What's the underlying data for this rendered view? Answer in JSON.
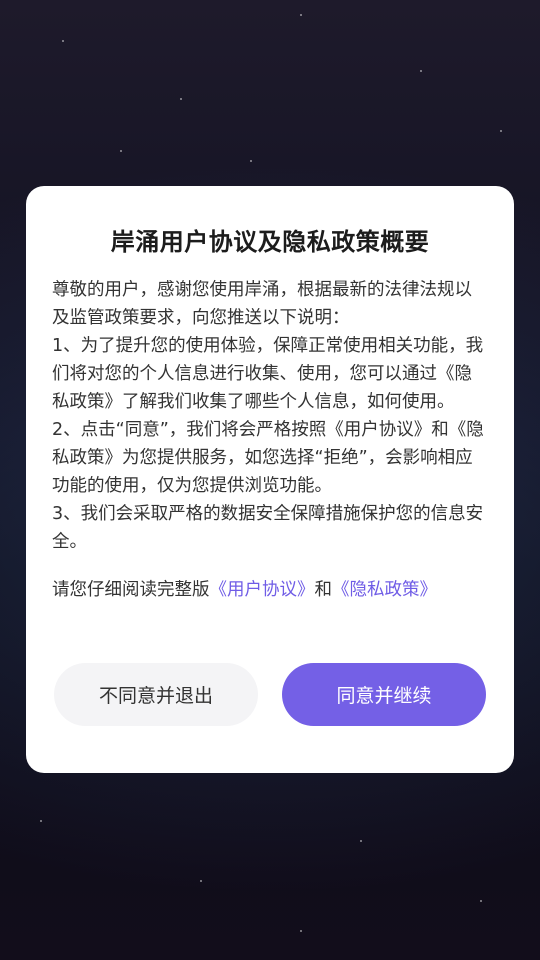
{
  "dialog": {
    "title": "岸涌用户协议及隐私政策概要",
    "paragraphs": [
      "尊敬的用户，感谢您使用岸涌，根据最新的法律法规以及监管政策要求，向您推送以下说明：",
      "1、为了提升您的使用体验，保障正常使用相关功能，我们将对您的个人信息进行收集、使用，您可以通过《隐私政策》了解我们收集了哪些个人信息，如何使用。",
      "2、点击“同意”，我们将会严格按照《用户协议》和《隐私政策》为您提供服务，如您选择“拒绝”，会影响相应功能的使用，仅为您提供浏览功能。",
      "3、我们会采取严格的数据安全保障措施保护您的信息安全。"
    ],
    "read_prefix": "请您仔细阅读完整版",
    "user_agreement_link": "《用户协议》",
    "read_and": "和",
    "privacy_policy_link": "《隐私政策》",
    "decline_label": "不同意并退出",
    "accept_label": "同意并继续"
  },
  "colors": {
    "accent": "#7460e6",
    "link": "#6f5ce6",
    "decline_bg": "#f4f4f6"
  }
}
